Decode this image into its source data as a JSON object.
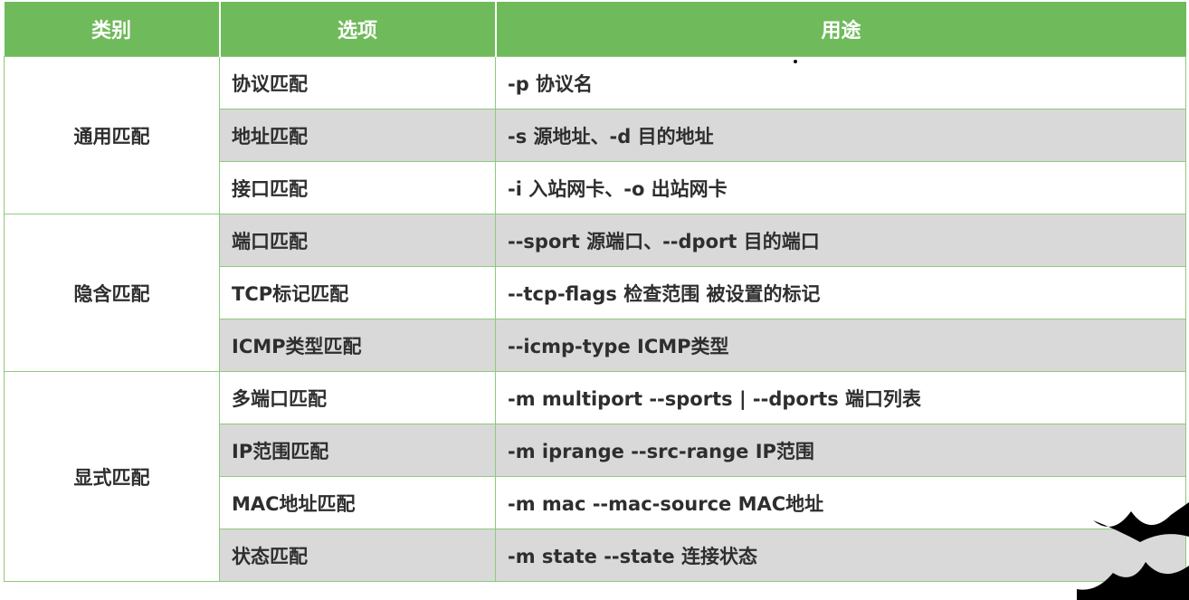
{
  "headers": {
    "category": "类别",
    "option": "选项",
    "purpose": "用途"
  },
  "groups": [
    {
      "category": "通用匹配",
      "rows": [
        {
          "option": "协议匹配",
          "purpose": "-p 协议名"
        },
        {
          "option": "地址匹配",
          "purpose": "-s 源地址、-d 目的地址"
        },
        {
          "option": "接口匹配",
          "purpose": "-i 入站网卡、-o 出站网卡"
        }
      ]
    },
    {
      "category": "隐含匹配",
      "rows": [
        {
          "option": "端口匹配",
          "purpose": "--sport 源端口、--dport 目的端口"
        },
        {
          "option": "TCP标记匹配",
          "purpose": "--tcp-flags 检查范围 被设置的标记"
        },
        {
          "option": "ICMP类型匹配",
          "purpose": "--icmp-type ICMP类型"
        }
      ]
    },
    {
      "category": "显式匹配",
      "rows": [
        {
          "option": "多端口匹配",
          "purpose": "-m multiport --sports | --dports 端口列表"
        },
        {
          "option": "IP范围匹配",
          "purpose": "-m iprange --src-range IP范围"
        },
        {
          "option": "MAC地址匹配",
          "purpose": "-m mac --mac-source MAC地址"
        },
        {
          "option": "状态匹配",
          "purpose": "-m state --state 连接状态"
        }
      ]
    }
  ],
  "colors": {
    "header_bg": "#6fba5b",
    "border": "#8fc97e",
    "row_shade": "#d9d9d9"
  }
}
